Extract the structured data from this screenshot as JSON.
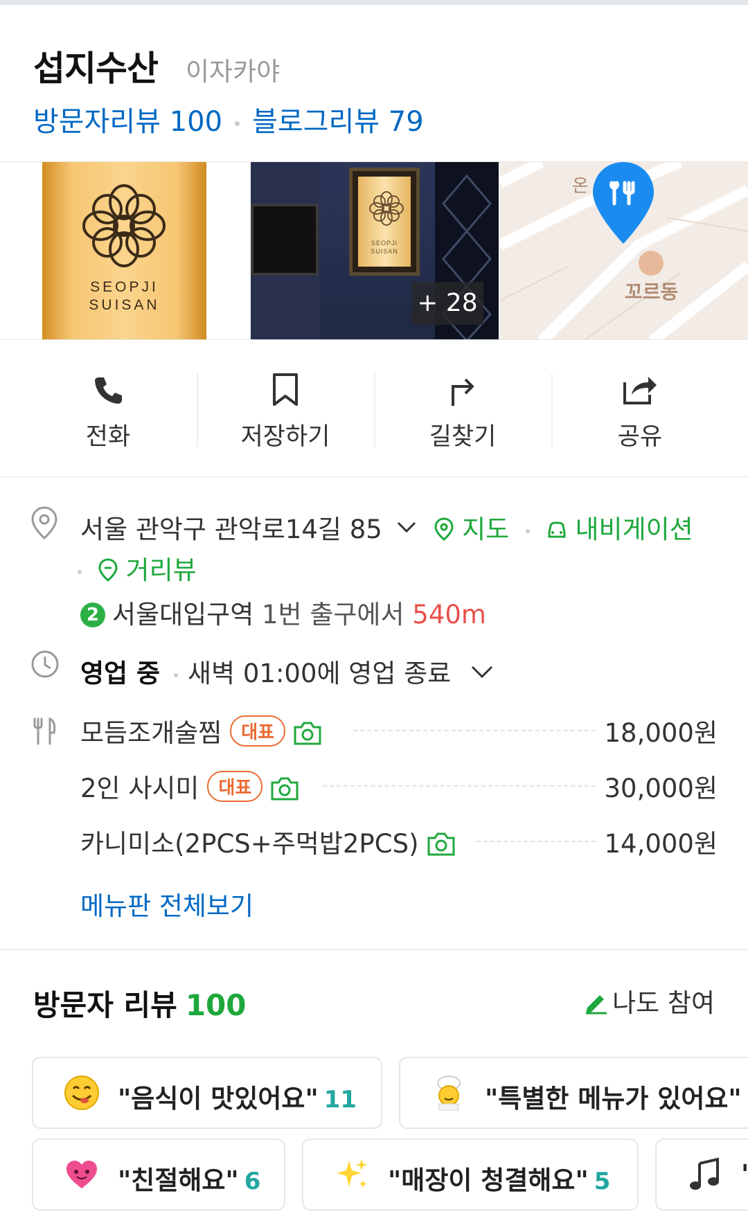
{
  "place": {
    "name": "섭지수산",
    "category": "이자카야",
    "visitor_reviews": "방문자리뷰 100",
    "blog_reviews": "블로그리뷰 79"
  },
  "photos": {
    "sign_text_line1": "SEOPJI",
    "sign_text_line2": "SUISAN",
    "more_count": "+ 28",
    "map_label_main": "꼬르동",
    "map_label_partial": "온"
  },
  "actions": [
    {
      "label": "전화",
      "icon": "phone-icon"
    },
    {
      "label": "저장하기",
      "icon": "bookmark-icon"
    },
    {
      "label": "길찾기",
      "icon": "directions-icon"
    },
    {
      "label": "공유",
      "icon": "share-icon"
    }
  ],
  "info": {
    "address": "서울 관악구 관악로14길 85",
    "map_link": "지도",
    "navigation_link": "내비게이션",
    "street_view_link": "거리뷰",
    "subway_line": "2",
    "subway_station": "서울대입구역",
    "subway_exit": "1번 출구에서",
    "subway_distance": "540m",
    "status": "영업 중",
    "hours_text": "새벽 01:00에 영업 종료"
  },
  "menu": {
    "rep_label": "대표",
    "items": [
      {
        "name": "모듬조개술찜",
        "price": "18,000원"
      },
      {
        "name": "2인 사시미",
        "price": "30,000원"
      },
      {
        "name": "카니미소(2PCS+주먹밥2PCS)",
        "price": "14,000원"
      }
    ],
    "view_all": "메뉴판 전체보기"
  },
  "reviews": {
    "title": "방문자 리뷰",
    "count": "100",
    "join": "나도 참여",
    "keywords": [
      {
        "text": "\"음식이 맛있어요\"",
        "count": "11",
        "icon": "yum-face-icon"
      },
      {
        "text": "\"특별한 메뉴가 있어요\"",
        "count": "",
        "icon": "chef-icon"
      },
      {
        "text": "\"친절해요\"",
        "count": "6",
        "icon": "heart-icon"
      },
      {
        "text": "\"매장이 청결해요\"",
        "count": "5",
        "icon": "sparkles-icon"
      },
      {
        "text": "\"",
        "count": "",
        "icon": "music-note-icon"
      }
    ]
  },
  "colors": {
    "link_blue": "#0068c3",
    "green": "#1ea83c",
    "pin_blue": "#1a8cf0",
    "rep_orange": "#ea6a31",
    "distance_red": "#e8504a",
    "review_count_teal": "#22a6a1"
  }
}
